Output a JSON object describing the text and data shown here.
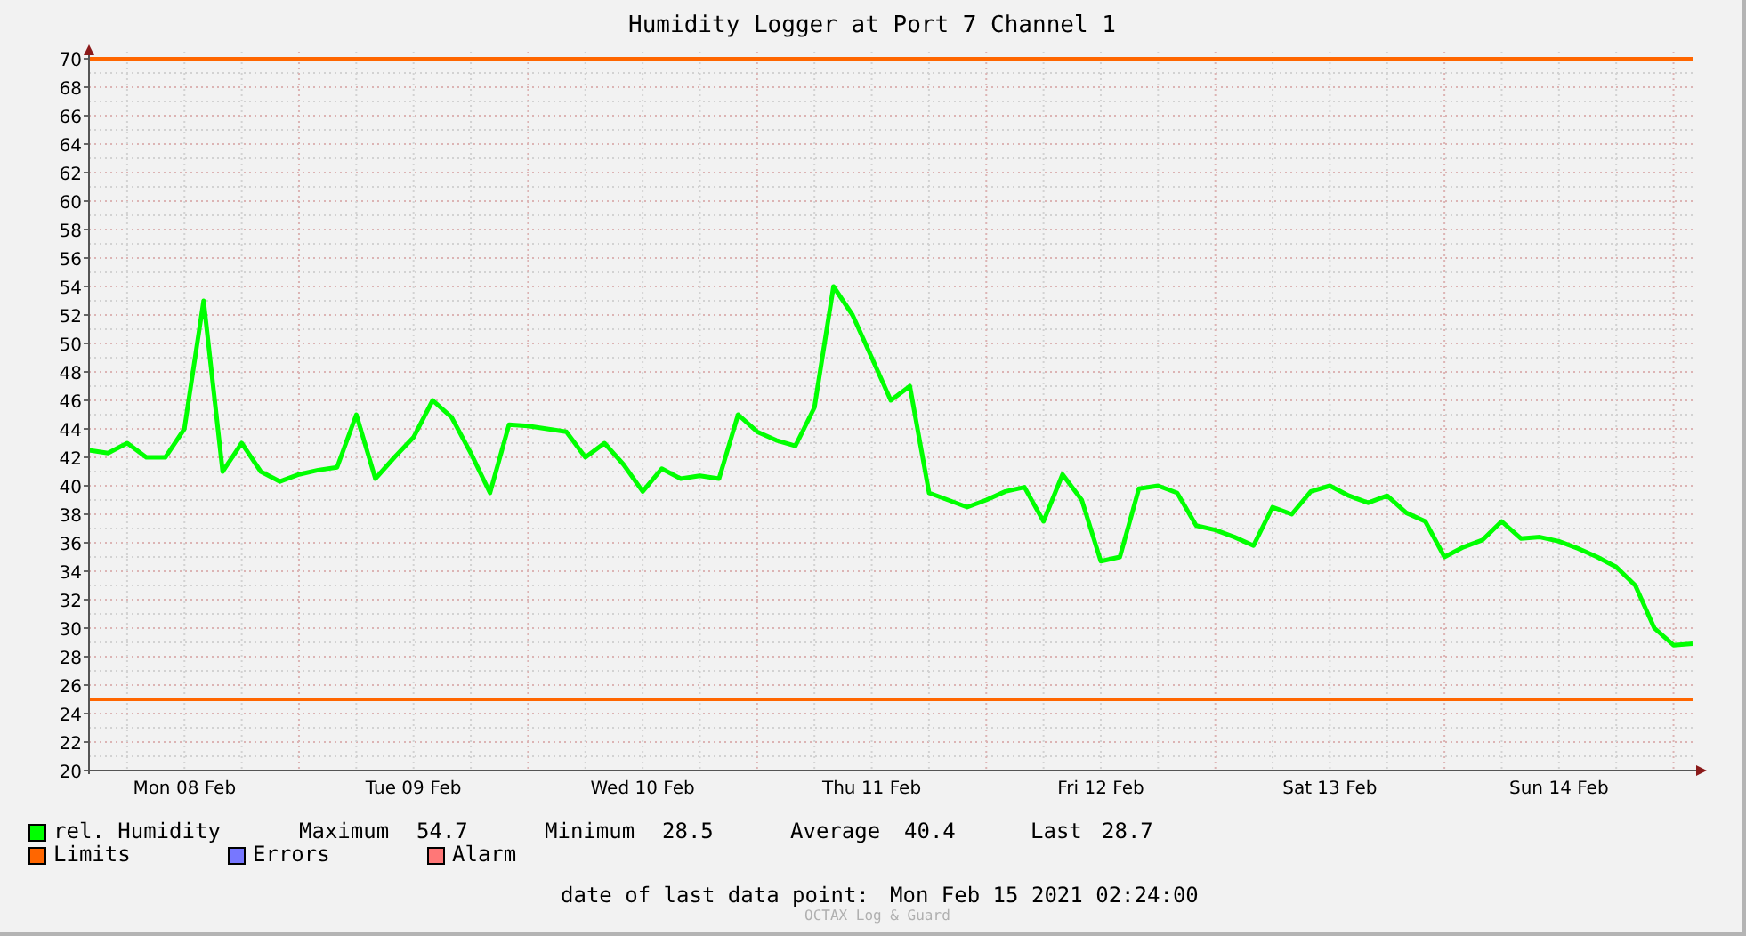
{
  "chart": {
    "chart_data": {
      "type": "line",
      "title": "Humidity Logger at Port 7 Channel 1",
      "categories": [
        null,
        null,
        null,
        null,
        null,
        "Mon 08 Feb",
        null,
        null,
        null,
        null,
        null,
        null,
        null,
        null,
        null,
        null,
        null,
        "Tue 09 Feb",
        null,
        null,
        null,
        null,
        null,
        null,
        null,
        null,
        null,
        null,
        null,
        "Wed 10 Feb",
        null,
        null,
        null,
        null,
        null,
        null,
        null,
        null,
        null,
        null,
        null,
        "Thu 11 Feb",
        null,
        null,
        null,
        null,
        null,
        null,
        null,
        null,
        null,
        null,
        null,
        "Fri 12 Feb",
        null,
        null,
        null,
        null,
        null,
        null,
        null,
        null,
        null,
        null,
        null,
        "Sat 13 Feb",
        null,
        null,
        null,
        null,
        null,
        null,
        null,
        null,
        null,
        null,
        null,
        "Sun 14 Feb",
        null,
        null,
        null,
        null,
        null,
        null,
        null
      ],
      "series": [
        {
          "name": "rel. Humidity",
          "color": "#00ff00",
          "values": [
            42.5,
            42.3,
            43,
            42,
            42,
            44,
            53,
            41,
            43,
            41,
            40.3,
            40.8,
            41.1,
            41.3,
            45,
            40.5,
            42,
            43.4,
            46,
            44.8,
            42.3,
            39.5,
            44.3,
            44.2,
            44,
            43.8,
            42,
            43,
            41.5,
            39.6,
            41.2,
            40.5,
            40.7,
            40.5,
            45,
            43.8,
            43.2,
            42.8,
            45.5,
            54,
            52,
            49,
            46,
            47,
            39.5,
            39,
            38.5,
            39,
            39.6,
            39.9,
            37.5,
            40.8,
            39,
            34.7,
            35,
            39.8,
            40,
            39.5,
            37.2,
            36.9,
            36.4,
            35.8,
            38.5,
            38,
            39.6,
            40,
            39.3,
            38.8,
            39.3,
            38.1,
            37.5,
            35,
            35.7,
            36.2,
            37.5,
            36.3,
            36.4,
            36.1,
            35.6,
            35,
            34.3,
            33,
            30,
            28.8,
            28.9
          ]
        }
      ],
      "ylim": [
        20,
        70
      ],
      "yticks": [
        20,
        22,
        24,
        26,
        28,
        30,
        32,
        34,
        36,
        38,
        40,
        42,
        44,
        46,
        48,
        50,
        52,
        54,
        56,
        58,
        60,
        62,
        64,
        66,
        68,
        70
      ],
      "grid": true,
      "ref_lines": [
        {
          "axis": "y",
          "value": 70
        },
        {
          "axis": "y",
          "value": 25
        }
      ]
    }
  },
  "stats": [
    {
      "label": "Maximum",
      "value": "54.7"
    },
    {
      "label": "Minimum",
      "value": "28.5"
    },
    {
      "label": "Average",
      "value": "40.4"
    },
    {
      "label": "Last",
      "value": "28.7"
    }
  ],
  "legend": [
    {
      "label": "Limits",
      "color": "#ff6600"
    },
    {
      "label": "Errors",
      "color": "#7777ff"
    },
    {
      "label": "Alarm",
      "color": "#ff7777"
    }
  ],
  "last_data_point": {
    "label": "date of last data point:",
    "value": "Mon Feb 15 2021 02:24:00"
  },
  "footer": "OCTAX Log & Guard"
}
